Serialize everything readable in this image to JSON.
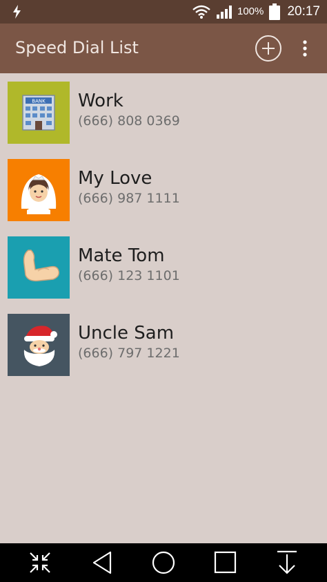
{
  "status_bar": {
    "battery_percent": "100%",
    "time": "20:17",
    "icons": [
      "charging-bolt-icon",
      "wifi-icon",
      "signal-icon",
      "battery-icon"
    ]
  },
  "app_bar": {
    "title": "Speed Dial List",
    "icons": [
      "add-circle-icon",
      "more-vert-icon"
    ]
  },
  "contacts": [
    {
      "name": "Work",
      "phone": "(666) 808 0369",
      "icon": "bank-building-icon",
      "color": "#b0b82a"
    },
    {
      "name": "My Love",
      "phone": "(666) 987 1111",
      "icon": "bride-icon",
      "color": "#f77f00"
    },
    {
      "name": "Mate Tom",
      "phone": "(666) 123 1101",
      "icon": "flexed-bicep-icon",
      "color": "#1a9fb0"
    },
    {
      "name": "Uncle Sam",
      "phone": "(666) 797 1221",
      "icon": "santa-icon",
      "color": "#455561"
    }
  ],
  "nav_bar": {
    "icons": [
      "collapse-icon",
      "back-triangle-icon",
      "home-circle-icon",
      "recents-square-icon",
      "download-arrow-icon"
    ]
  },
  "colors": {
    "status_bar": "#5a3e31",
    "app_bar": "#7b5646",
    "background": "#d9ceca",
    "nav_bar": "#000000"
  }
}
